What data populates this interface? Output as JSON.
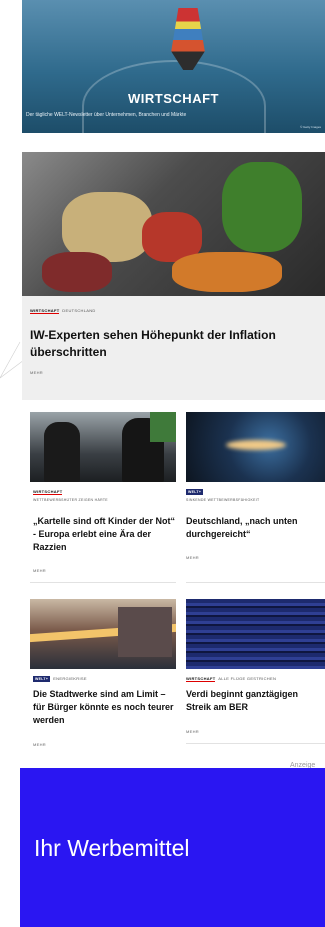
{
  "banner": {
    "title": "WIRTSCHAFT",
    "subtitle": "Der tägliche WELT-Newsletter über Unternehmen, Branchen und Märkte",
    "credit": "© Getty Images"
  },
  "hero": {
    "kicker_primary": "WIRTSCHAFT",
    "kicker_secondary": "DEUTSCHLAND",
    "title": "IW-Experten sehen Höhepunkt der Inflation überschritten",
    "more": "MEHR"
  },
  "articles": [
    {
      "kicker_primary": "WIRTSCHAFT",
      "kicker_secondary": "WETTBEWERBSHÜTER ZEIGEN HÄRTE",
      "badge": "",
      "title": "„Kartelle sind oft Kinder der Not“ - Europa erlebt eine Ära der Razzien",
      "more": "MEHR"
    },
    {
      "kicker_primary": "",
      "kicker_secondary": "SINKENDE WETTBEWERBSFÄHIGKEIT",
      "badge": "WELT+",
      "title": "Deutschland, „nach unten durchgereicht“",
      "more": "MEHR"
    },
    {
      "kicker_primary": "",
      "kicker_secondary": "ENERGIEKRISE",
      "badge": "WELT+",
      "title": "Die Stadtwerke sind am Limit – für Bürger könnte es noch teurer werden",
      "more": "MEHR"
    },
    {
      "kicker_primary": "WIRTSCHAFT",
      "kicker_secondary": "ALLE FLÜGE GESTRICHEN",
      "badge": "",
      "title": "Verdi beginnt ganztägigen Streik am BER",
      "more": "MEHR"
    }
  ],
  "ad": {
    "label": "Anzeige",
    "text": "Ihr Werbemittel"
  }
}
